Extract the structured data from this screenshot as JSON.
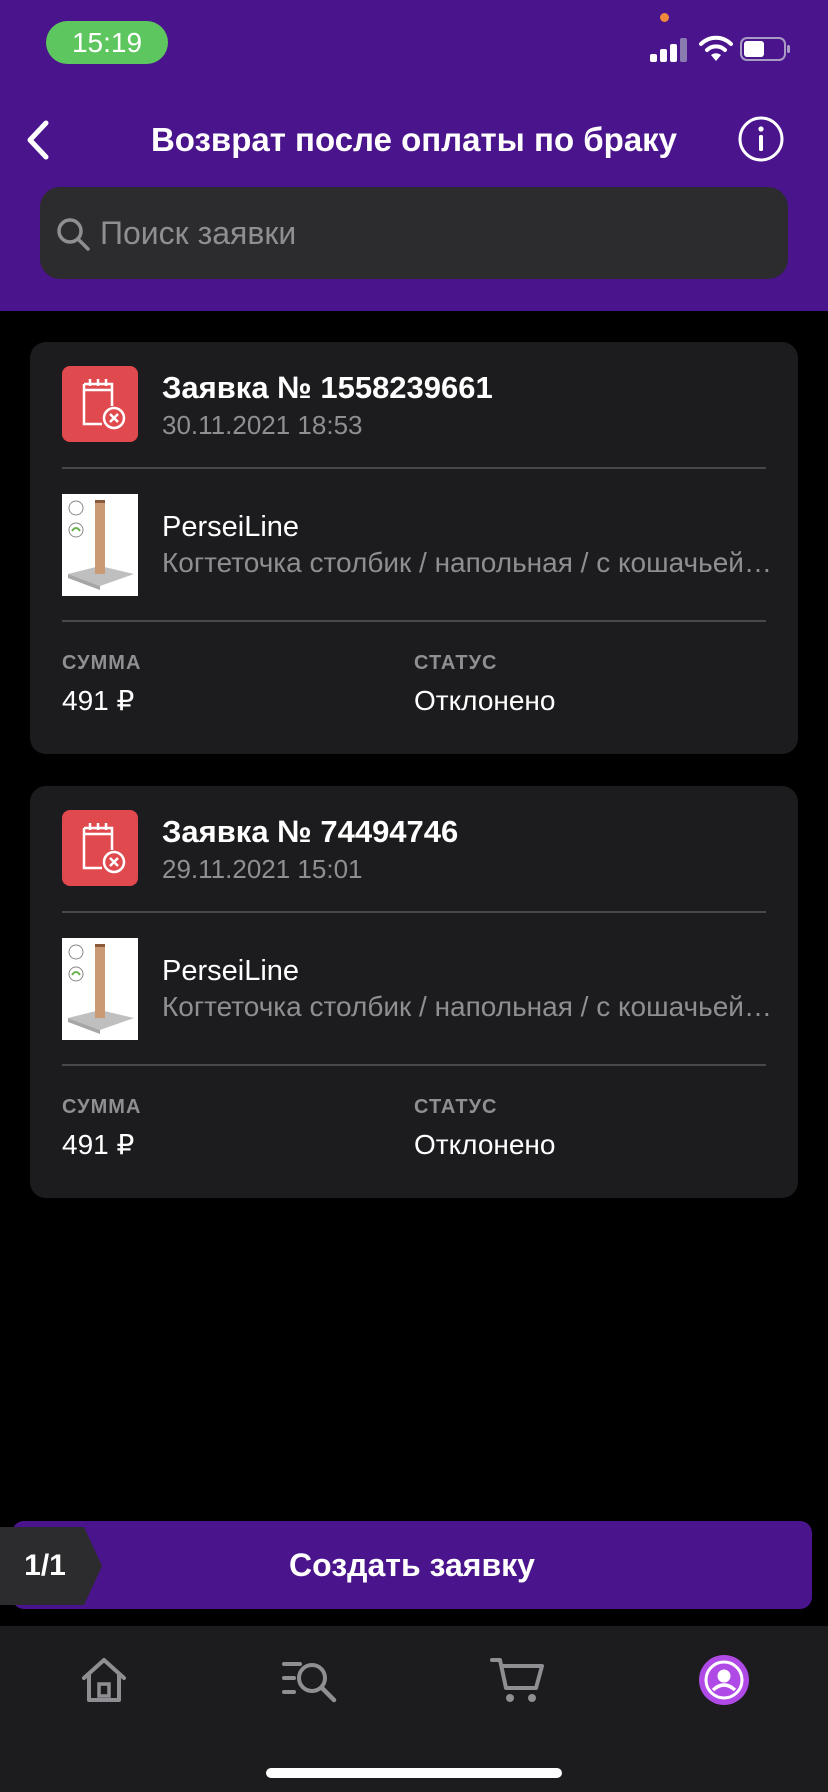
{
  "status_bar": {
    "time": "15:19"
  },
  "header": {
    "title": "Возврат после оплаты по браку",
    "back_icon": "chevron-left-icon",
    "info_icon": "info-circle-icon"
  },
  "search": {
    "placeholder": "Поиск заявки"
  },
  "requests": [
    {
      "title": "Заявка № 1558239661",
      "date": "30.11.2021 18:53",
      "brand": "PerseiLine",
      "product": "Когтеточка столбик / напольная / с кошачьей мятой",
      "sum_label": "СУММА",
      "sum": "491 ₽",
      "status_label": "СТАТУС",
      "status": "Отклонено"
    },
    {
      "title": "Заявка № 74494746",
      "date": "29.11.2021 15:01",
      "brand": "PerseiLine",
      "product": "Когтеточка столбик / напольная / с кошачьей мятой",
      "sum_label": "СУММА",
      "sum": "491 ₽",
      "status_label": "СТАТУС",
      "status": "Отклонено"
    }
  ],
  "footer": {
    "pager": "1/1",
    "create_label": "Создать заявку"
  },
  "tabbar": {
    "items": [
      "home-icon",
      "catalog-search-icon",
      "cart-icon",
      "profile-icon"
    ]
  },
  "colors": {
    "accent": "#4a148c",
    "reject_icon_bg": "#e04a4f",
    "card_bg": "#1c1c1e",
    "profile_accent": "#b04ae6"
  }
}
